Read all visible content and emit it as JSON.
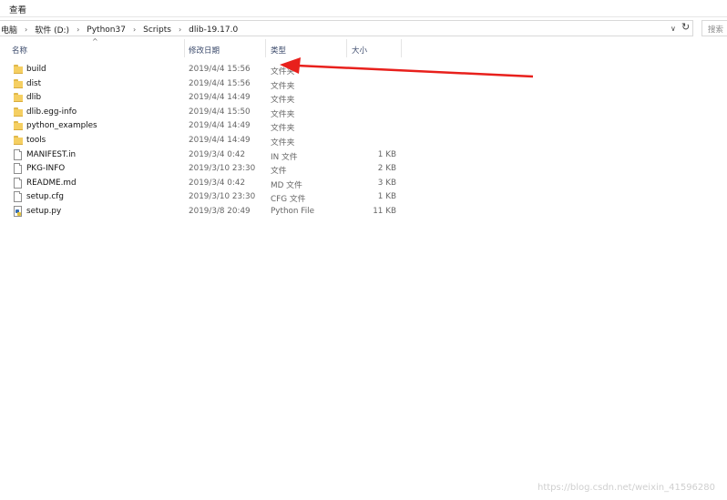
{
  "ribbon": {
    "tab_view": "查看"
  },
  "address": {
    "crumbs": [
      "电脑",
      "软件 (D:)",
      "Python37",
      "Scripts",
      "dlib-19.17.0"
    ],
    "search_placeholder": "搜索"
  },
  "columns": {
    "name": "名称",
    "date": "修改日期",
    "type": "类型",
    "size": "大小"
  },
  "files": [
    {
      "icon": "folder-icon",
      "name": "build",
      "date": "2019/4/4 15:56",
      "type": "文件夹",
      "size": ""
    },
    {
      "icon": "folder-icon",
      "name": "dist",
      "date": "2019/4/4 15:56",
      "type": "文件夹",
      "size": ""
    },
    {
      "icon": "folder-icon",
      "name": "dlib",
      "date": "2019/4/4 14:49",
      "type": "文件夹",
      "size": ""
    },
    {
      "icon": "folder-icon",
      "name": "dlib.egg-info",
      "date": "2019/4/4 15:50",
      "type": "文件夹",
      "size": ""
    },
    {
      "icon": "folder-icon",
      "name": "python_examples",
      "date": "2019/4/4 14:49",
      "type": "文件夹",
      "size": ""
    },
    {
      "icon": "folder-icon",
      "name": "tools",
      "date": "2019/4/4 14:49",
      "type": "文件夹",
      "size": ""
    },
    {
      "icon": "file-icon",
      "name": "MANIFEST.in",
      "date": "2019/3/4 0:42",
      "type": "IN 文件",
      "size": "1 KB"
    },
    {
      "icon": "file-icon",
      "name": "PKG-INFO",
      "date": "2019/3/10 23:30",
      "type": "文件",
      "size": "2 KB"
    },
    {
      "icon": "file-icon",
      "name": "README.md",
      "date": "2019/3/4 0:42",
      "type": "MD 文件",
      "size": "3 KB"
    },
    {
      "icon": "file-icon",
      "name": "setup.cfg",
      "date": "2019/3/10 23:30",
      "type": "CFG 文件",
      "size": "1 KB"
    },
    {
      "icon": "python-file-icon",
      "name": "setup.py",
      "date": "2019/3/8 20:49",
      "type": "Python File",
      "size": "11 KB"
    }
  ],
  "watermark": "https://blog.csdn.net/weixin_41596280",
  "colors": {
    "annotation_arrow": "#e8201c",
    "folder": "#f5cf62",
    "header_text": "#3b4a6b"
  }
}
